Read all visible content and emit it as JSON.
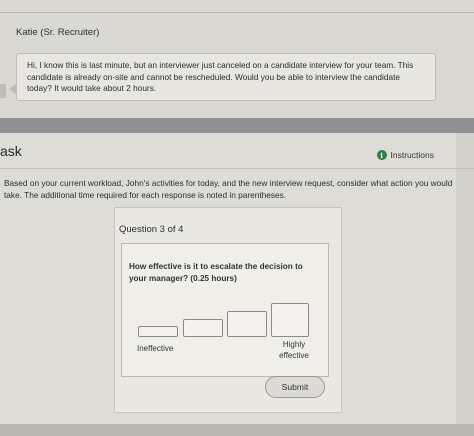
{
  "chat": {
    "sender": "Katie (Sr. Recruiter)",
    "message": "Hi, I know this is last minute, but an interviewer just canceled on a candidate interview for your team. This candidate is already on-site and cannot be rescheduled. Would you be able to interview the candidate today? It would take about 2 hours."
  },
  "task": {
    "title": "ask",
    "instructions_label": "Instructions",
    "info_icon_glyph": "i",
    "description": "Based on your current workload, John's activities for today, and the new interview request, consider what action you would take. The additional time required for each response is noted in parentheses."
  },
  "question": {
    "number_label": "Question 3 of 4",
    "text": "How effective is it to escalate the decision to your manager? (0.25 hours)",
    "scale_low_label": "Ineffective",
    "scale_high_label": "Highly effective",
    "options_count": 4,
    "selected": null
  },
  "submit_label": "Submit",
  "colors": {
    "info_icon": "#2f7d4a",
    "dark_band": "#8f9092"
  }
}
